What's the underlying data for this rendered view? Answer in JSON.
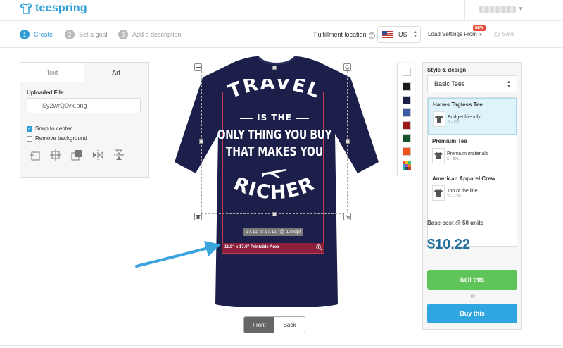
{
  "app": {
    "logo_text": "teespring"
  },
  "steps": [
    {
      "num": "1",
      "label": "Create"
    },
    {
      "num": "2",
      "label": "Set a goal"
    },
    {
      "num": "3",
      "label": "Add a description"
    }
  ],
  "header": {
    "fulfillment_label": "Fulfillment location",
    "country": "US",
    "load_settings": "Load Settings From",
    "new_badge": "NEW",
    "save": "Save"
  },
  "left_panel": {
    "tabs": [
      "Text",
      "Art"
    ],
    "uploaded_file_label": "Uploaded File",
    "uploaded_file_name": "Sy2wrQ0vx.png",
    "snap_to_center": "Snap to center",
    "snap_checked": true,
    "remove_background": "Remove background",
    "remove_bg_checked": false
  },
  "canvas": {
    "art_lines": [
      "TRAVEL",
      "IS THE",
      "ONLY THING YOU BUY",
      "THAT MAKES YOU",
      "RICHER"
    ],
    "dims_tag": "17.11\" x 17.11\" @ 175dpi",
    "printable_area": "11.9\" x 17.9\" Printable Area",
    "shirt_color": "#1c1f4a",
    "view_tabs": [
      "Front",
      "Back"
    ]
  },
  "swatches": [
    "#ffffff",
    "#1b1b1b",
    "#1c1f4a",
    "#3b5aa6",
    "#9c1a1a",
    "#14502c",
    "#f0521e"
  ],
  "right_panel": {
    "style_label": "Style & design",
    "product_select": "Basic Tees",
    "products": [
      {
        "name": "Hanes Tagless Tee",
        "desc": "Budget friendly",
        "sizes": "S – 5XL"
      },
      {
        "name": "Premium Tee",
        "desc": "Premium materials",
        "sizes": "S – 5XL"
      },
      {
        "name": "American Apparel Crew",
        "desc": "Top of the line",
        "sizes": "XS – 3XL"
      }
    ],
    "base_cost_label": "Base cost @ 50 units",
    "price": "$10.22",
    "sell_button": "Sell this",
    "or_text": "or",
    "buy_button": "Buy this"
  }
}
